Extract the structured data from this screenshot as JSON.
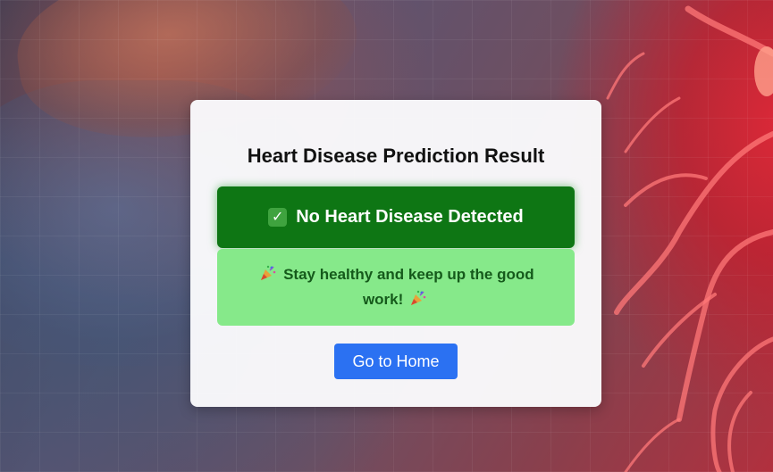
{
  "result": {
    "title": "Heart Disease Prediction Result",
    "status_label": "No Heart Disease Detected",
    "status_icon": "check-mark-icon",
    "message": "Stay healthy and keep up the good work!",
    "message_icon": "party-popper-icon",
    "home_button_label": "Go to Home"
  },
  "colors": {
    "status_background": "#0e7614",
    "message_background": "#86e98a",
    "message_text": "#155a1b",
    "button_background": "#2b71f2",
    "card_background": "#fafafc"
  }
}
